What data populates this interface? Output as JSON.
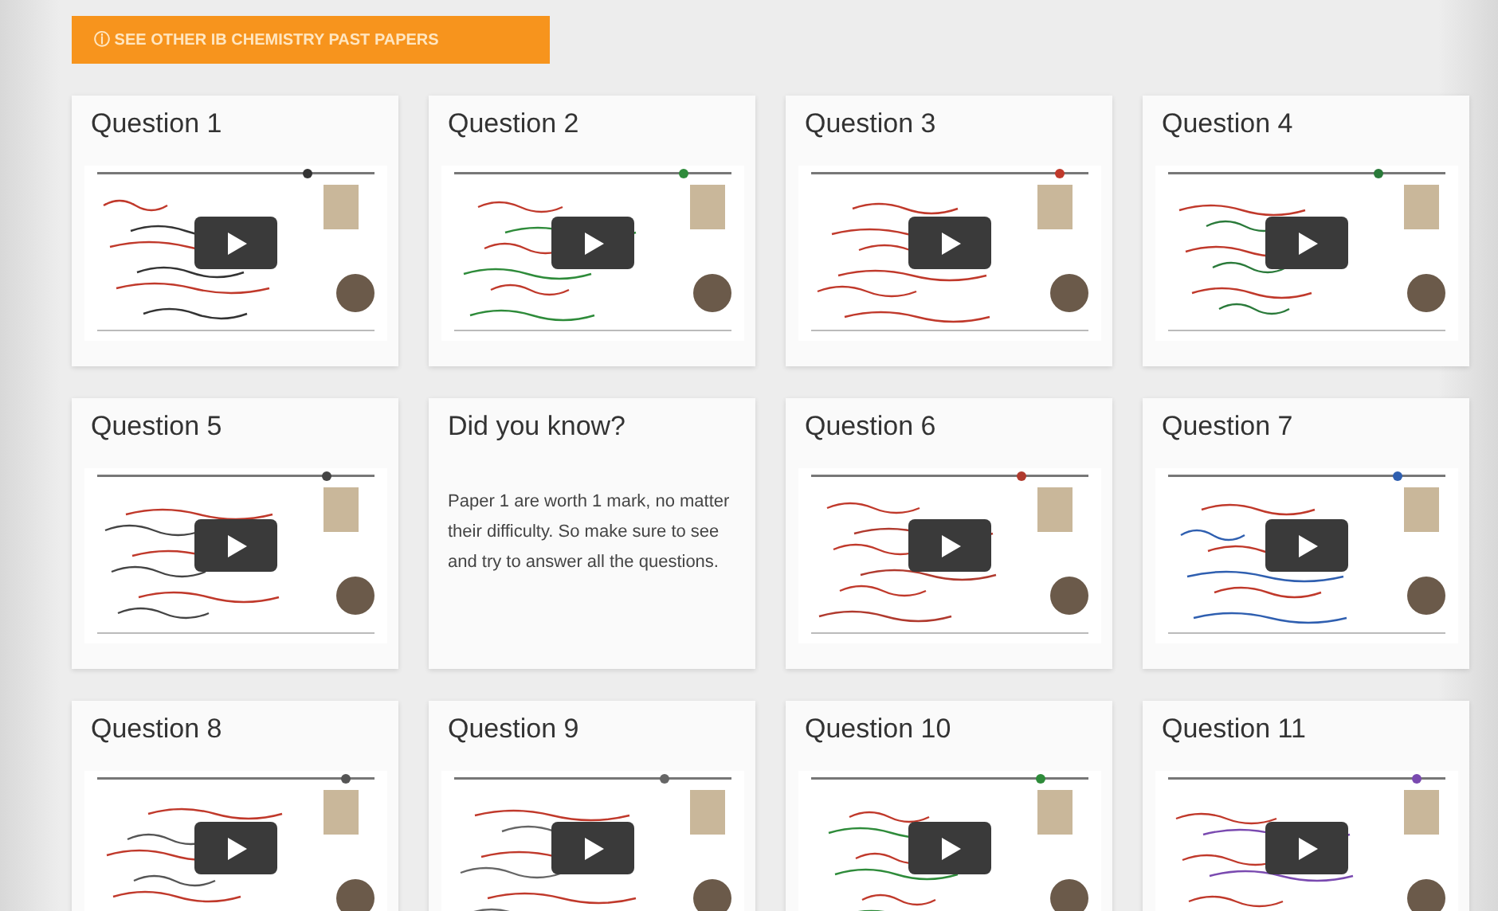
{
  "banner": {
    "icon": "ⓘ",
    "label": "SEE OTHER IB CHEMISTRY PAST PAPERS"
  },
  "cards": [
    {
      "kind": "video",
      "title": "Question 1"
    },
    {
      "kind": "video",
      "title": "Question 2"
    },
    {
      "kind": "video",
      "title": "Question 3"
    },
    {
      "kind": "video",
      "title": "Question 4"
    },
    {
      "kind": "video",
      "title": "Question 5"
    },
    {
      "kind": "tip",
      "title": "Did you know?",
      "text": "Paper 1 are worth 1 mark, no matter their difficulty. So make sure to see and try to answer all the questions."
    },
    {
      "kind": "video",
      "title": "Question 6"
    },
    {
      "kind": "video",
      "title": "Question 7"
    },
    {
      "kind": "video",
      "title": "Question 8"
    },
    {
      "kind": "video",
      "title": "Question 9"
    },
    {
      "kind": "video",
      "title": "Question 10"
    },
    {
      "kind": "video",
      "title": "Question 11"
    }
  ]
}
